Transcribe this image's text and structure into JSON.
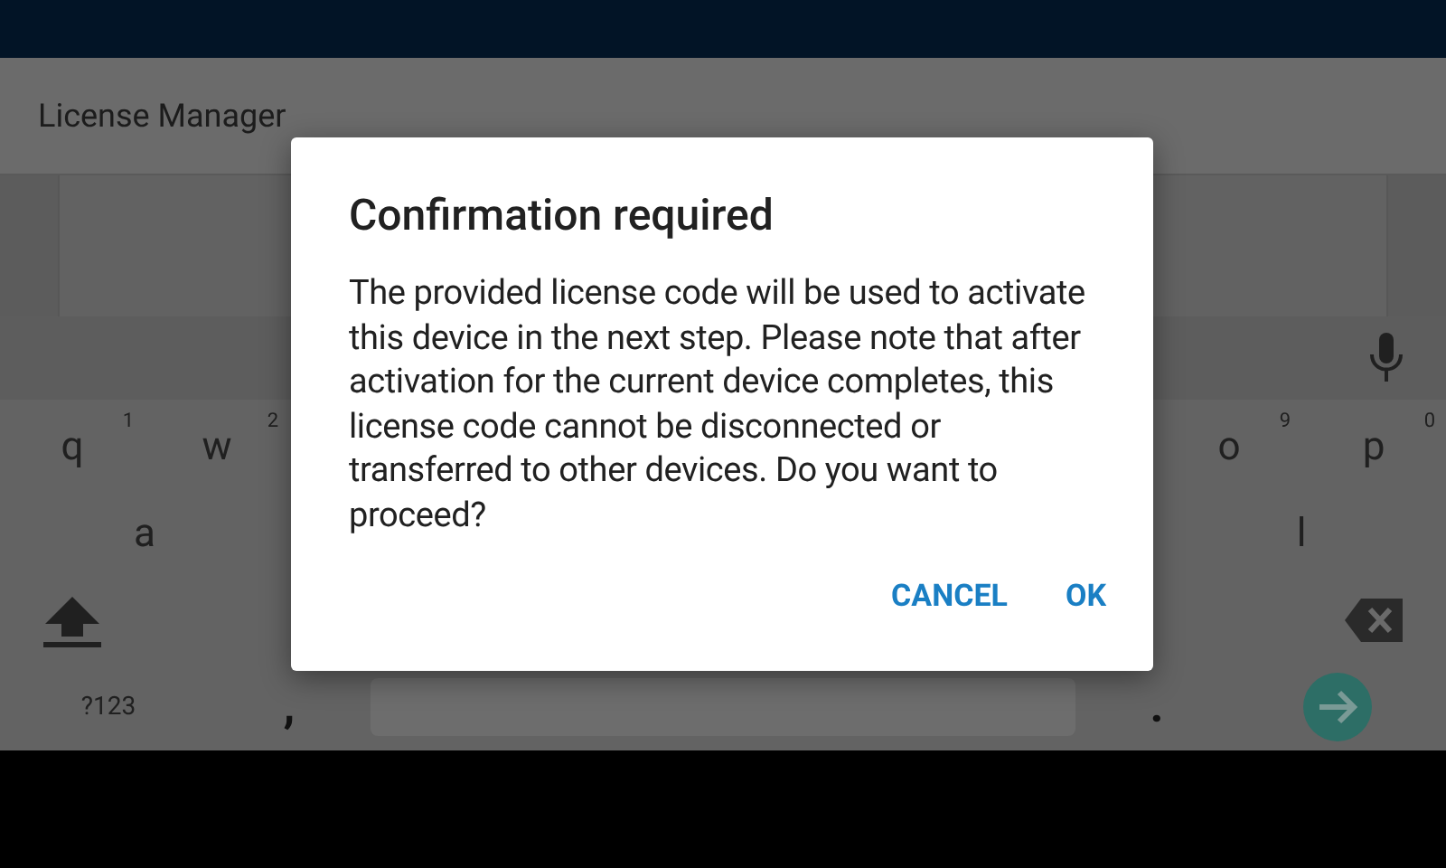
{
  "app_bar": {
    "title": "License Manager"
  },
  "keyboard": {
    "rows": [
      {
        "left": [
          {
            "kind": "letter",
            "label": "q",
            "hint": "1"
          },
          {
            "kind": "letter",
            "label": "w",
            "hint": "2"
          }
        ],
        "right": [
          {
            "kind": "letter",
            "label": "o",
            "hint": "9"
          },
          {
            "kind": "letter",
            "label": "p",
            "hint": "0"
          }
        ]
      },
      {
        "left": [
          {
            "kind": "letter",
            "label": "a"
          }
        ],
        "right": [
          {
            "kind": "letter",
            "label": "l"
          }
        ]
      },
      {
        "left": [
          {
            "kind": "shift"
          }
        ],
        "right": [
          {
            "kind": "backspace"
          }
        ]
      },
      {
        "left": [
          {
            "kind": "symbols",
            "label": "?123"
          },
          {
            "kind": "letter",
            "label": ","
          }
        ],
        "right": [
          {
            "kind": "letter",
            "label": "."
          },
          {
            "kind": "enter"
          }
        ]
      }
    ]
  },
  "dialog": {
    "title": "Confirmation required",
    "message": "The provided license code will be used to activate this device in the next step. Please note that after activation for the current device completes, this license code cannot be disconnected or transferred to other devices. Do you want to proceed?",
    "buttons": [
      "CANCEL",
      "OK"
    ]
  }
}
